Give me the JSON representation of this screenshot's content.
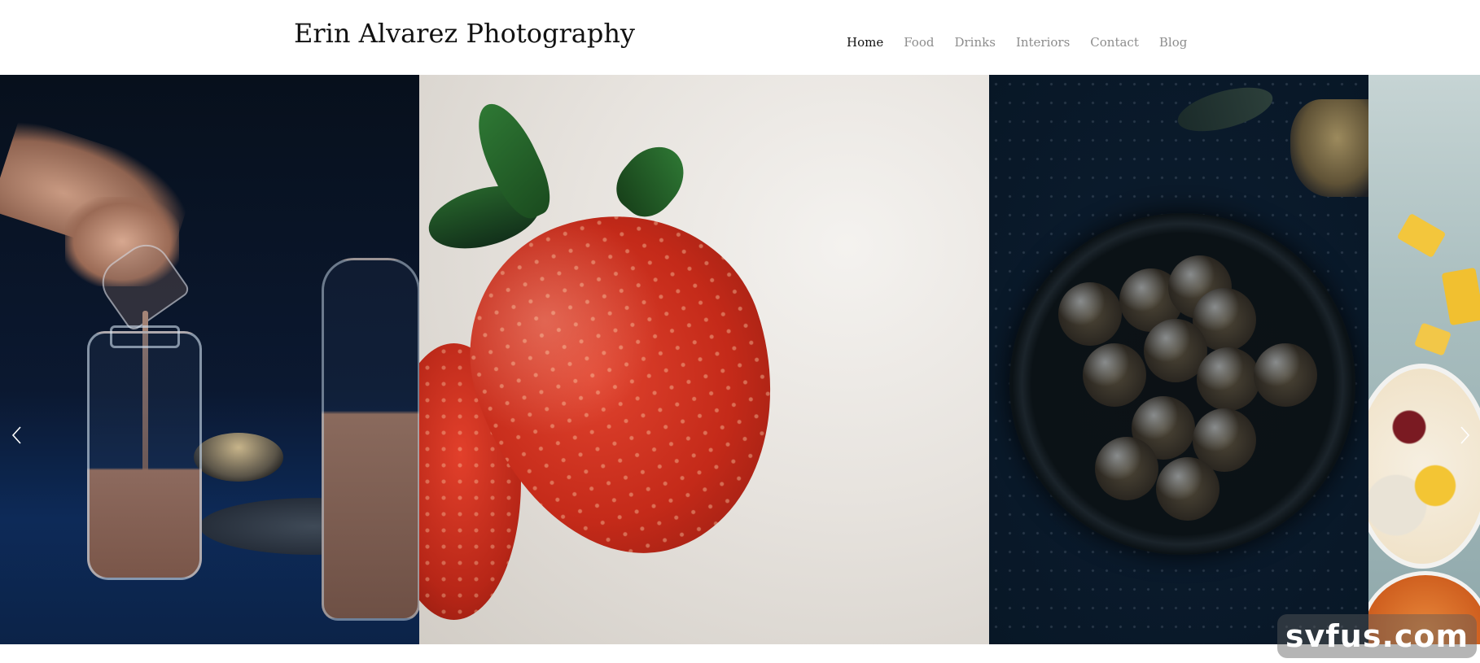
{
  "site": {
    "title": "Erin Alvarez Photography"
  },
  "nav": {
    "items": [
      {
        "label": "Home",
        "active": true
      },
      {
        "label": "Food",
        "active": false
      },
      {
        "label": "Drinks",
        "active": false
      },
      {
        "label": "Interiors",
        "active": false
      },
      {
        "label": "Contact",
        "active": false
      },
      {
        "label": "Blog",
        "active": false
      }
    ]
  },
  "slider": {
    "slides": [
      {
        "subject": "chocolate milk pouring into glass bottle"
      },
      {
        "subject": "strawberry close-up on linen"
      },
      {
        "subject": "coconut energy balls on dark plate"
      },
      {
        "subject": "fruit and yogurt bowls"
      }
    ],
    "prev_icon": "chevron-left-icon",
    "next_icon": "chevron-right-icon"
  },
  "watermark": {
    "text": "svfus.com"
  },
  "colors": {
    "nav_active": "#111111",
    "nav_inactive": "#8d8d8d",
    "background": "#ffffff"
  }
}
